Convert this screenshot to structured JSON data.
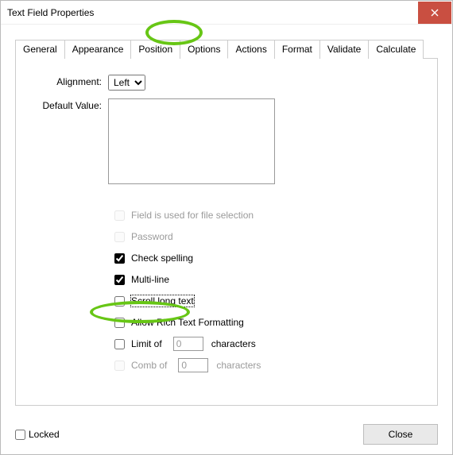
{
  "window": {
    "title": "Text Field Properties"
  },
  "tabs": {
    "general": "General",
    "appearance": "Appearance",
    "position": "Position",
    "options": "Options",
    "actions": "Actions",
    "format": "Format",
    "validate": "Validate",
    "calculate": "Calculate"
  },
  "form": {
    "alignment_label": "Alignment:",
    "alignment_value": "Left",
    "default_value_label": "Default Value:",
    "default_value": ""
  },
  "options": {
    "file_selection": "Field is used for file selection",
    "password": "Password",
    "check_spelling": "Check spelling",
    "multiline": "Multi-line",
    "scroll_long_text": "Scroll long text",
    "allow_rtf": "Allow Rich Text Formatting",
    "limit_of": "Limit of",
    "limit_chars_label": "characters",
    "limit_value": "0",
    "comb_of": "Comb of",
    "comb_chars_label": "characters",
    "comb_value": "0"
  },
  "footer": {
    "locked": "Locked",
    "close": "Close"
  }
}
